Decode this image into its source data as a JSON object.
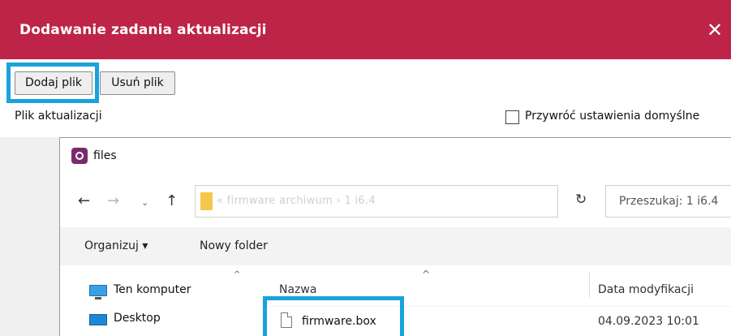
{
  "dialog": {
    "title": "Dodawanie zadania aktualizacji",
    "close_glyph": "✕",
    "header_color": "#be2448"
  },
  "toolbar": {
    "add_file_label": "Dodaj plik",
    "remove_file_label": "Usuń plik"
  },
  "form": {
    "update_file_label": "Plik aktualizacji",
    "restore_defaults_label": "Przywróć ustawienia domyślne",
    "restore_defaults_checked": false
  },
  "highlight_color": "#19a2dc",
  "file_dialog": {
    "title": "files",
    "nav": {
      "back_glyph": "←",
      "forward_glyph": "→",
      "recent_glyph": "⌄",
      "up_glyph": "↑",
      "refresh_glyph": "↻",
      "dropdown_glyph": "⌄"
    },
    "address_path": "« firmware archiwum › 1 i6.4",
    "search_placeholder": "Przeszukaj: 1 i6.4",
    "commands": {
      "organize_label": "Organizuj ▾",
      "new_folder_label": "Nowy folder"
    },
    "nav_pane": {
      "scroll_up_glyph": "^",
      "items": [
        {
          "label": "Ten komputer",
          "icon": "computer-icon"
        },
        {
          "label": "Desktop",
          "icon": "desktop-folder-icon"
        }
      ]
    },
    "columns": {
      "sort_caret": "^",
      "name": "Nazwa",
      "date_modified": "Data modyfikacji"
    },
    "files": [
      {
        "name": "firmware.box",
        "date_modified": "04.09.2023 10:01",
        "icon": "file-icon"
      }
    ]
  }
}
